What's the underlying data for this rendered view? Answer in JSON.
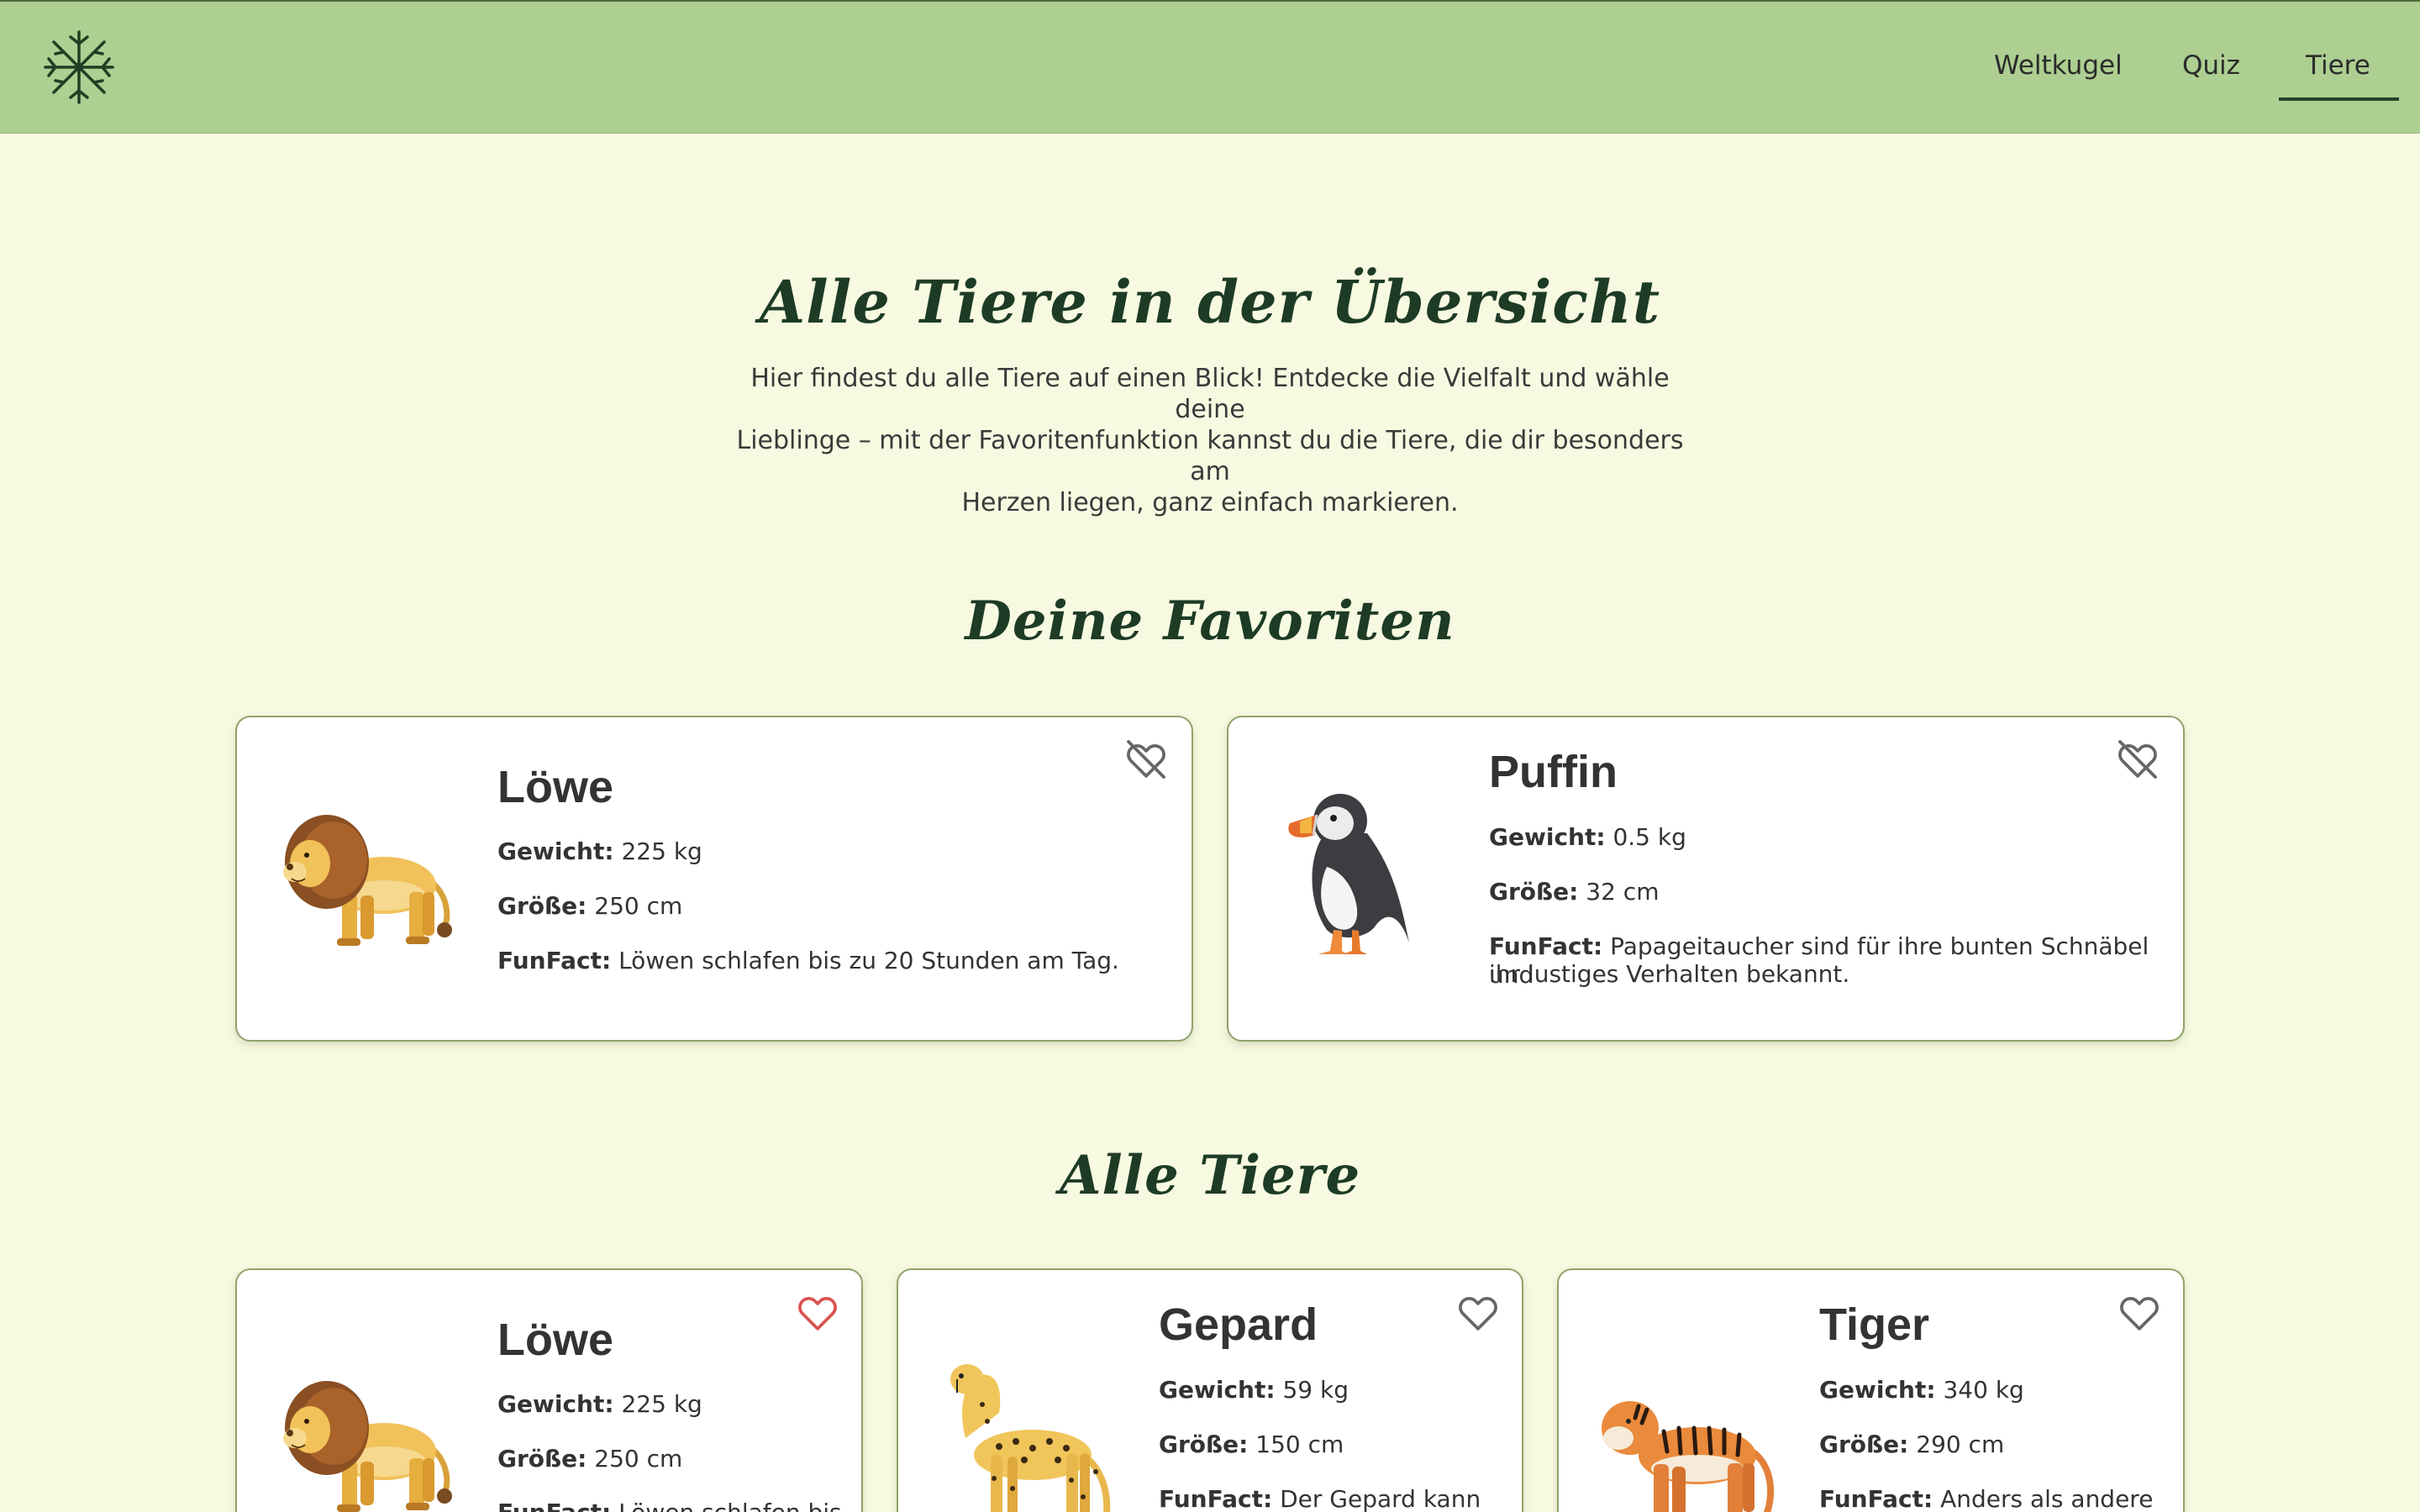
{
  "nav": {
    "items": [
      {
        "label": "Weltkugel"
      },
      {
        "label": "Quiz"
      },
      {
        "label": "Tiere",
        "active": true
      }
    ]
  },
  "page": {
    "title": "Alle Tiere in der Übersicht",
    "intro_lines": [
      "Hier findest du alle Tiere auf einen Blick! Entdecke die Vielfalt und wähle deine",
      "Lieblinge – mit der Favoritenfunktion kannst du die Tiere, die dir besonders am",
      "Herzen liegen, ganz einfach markieren."
    ]
  },
  "labels": {
    "weight": "Gewicht:",
    "size": "Größe:",
    "funfact": "FunFact:"
  },
  "favorites": {
    "title": "Deine Favoriten",
    "cards": [
      {
        "name": "Löwe",
        "weight": "225 kg",
        "size": "250 cm",
        "funfact_lines": [
          "Löwen schlafen bis zu 20 Stunden am Tag."
        ],
        "icon": "heart-off-icon"
      },
      {
        "name": "Puffin",
        "weight": "0.5 kg",
        "size": "32 cm",
        "funfact_lines": [
          "Papageitaucher sind für ihre bunten Schnäbel und",
          "ihr lustiges Verhalten bekannt."
        ],
        "icon": "heart-off-icon"
      }
    ]
  },
  "all": {
    "title": "Alle Tiere",
    "cards": [
      {
        "name": "Löwe",
        "weight": "225 kg",
        "size": "250 cm",
        "funfact_partial": "Löwen schlafen bis",
        "favorited": true,
        "icon": "heart-icon",
        "icon_color": "#d9534f"
      },
      {
        "name": "Gepard",
        "weight": "59 kg",
        "size": "150 cm",
        "funfact_partial": "Der Gepard kann",
        "favorited": false,
        "icon": "heart-icon",
        "icon_color": "#666666"
      },
      {
        "name": "Tiger",
        "weight": "340 kg",
        "size": "290 cm",
        "funfact_partial": "Anders als andere",
        "favorited": false,
        "icon": "heart-icon",
        "icon_color": "#666666"
      }
    ]
  },
  "colors": {
    "header_bg": "#adcf91",
    "page_bg": "#f7fae1",
    "title": "#1d3b25",
    "card_border": "#8fa369",
    "heart_active": "#d9534f"
  }
}
